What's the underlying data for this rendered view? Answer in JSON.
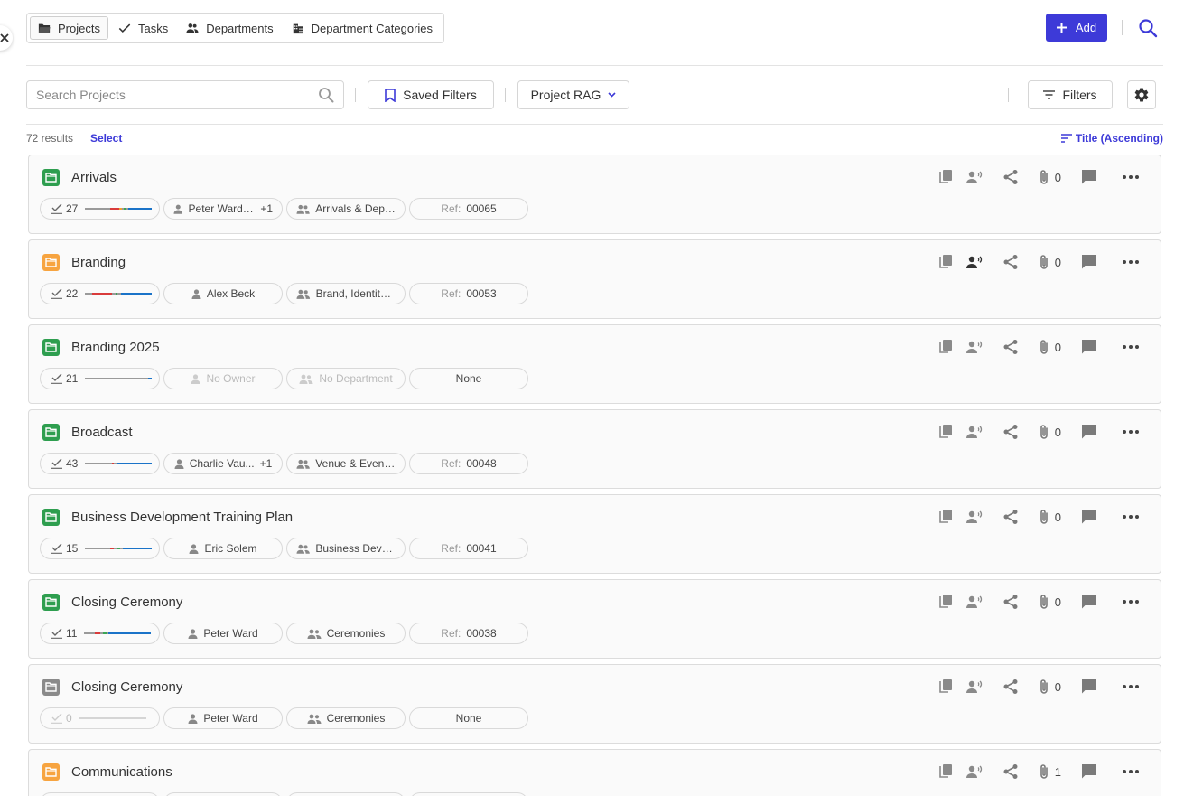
{
  "nav": {
    "tabs": [
      {
        "label": "Projects",
        "icon": "folder-open-icon",
        "active": true
      },
      {
        "label": "Tasks",
        "icon": "checkmark-icon",
        "active": false
      },
      {
        "label": "Departments",
        "icon": "people-icon",
        "active": false
      },
      {
        "label": "Department Categories",
        "icon": "building-icon",
        "active": false
      }
    ],
    "add_label": "Add"
  },
  "toolbar": {
    "search_placeholder": "Search Projects",
    "saved_filters_label": "Saved Filters",
    "rag_label": "Project RAG",
    "filters_label": "Filters"
  },
  "results": {
    "count_label": "72 results",
    "select_label": "Select",
    "sort_label": "Title (Ascending)"
  },
  "colors": {
    "accent": "#3d3ad8",
    "folder_green": "#2e9e4f",
    "folder_orange": "#f7a440",
    "folder_grey": "#8a8a8a",
    "rag_red": "#d93b3b",
    "rag_amber": "#f0a030",
    "rag_green": "#3aa655",
    "rag_blue": "#1a73c8",
    "rag_grey": "#9a9a9a"
  },
  "projects": [
    {
      "title": "Arrivals",
      "folder": "green",
      "tasks": "27",
      "owner": "Peter Ward, ...",
      "owner_extra": "+1",
      "dept": "Arrivals & Depa...",
      "ref_label": "Ref:",
      "ref": "00065",
      "attachments": "0",
      "rag": [
        [
          "grey",
          28
        ],
        [
          "red",
          10
        ],
        [
          "amber",
          3
        ],
        [
          "grey",
          2
        ],
        [
          "green",
          3
        ],
        [
          "grey",
          2
        ],
        [
          "blue",
          26
        ]
      ]
    },
    {
      "title": "Branding",
      "folder": "orange",
      "tasks": "22",
      "owner": "Alex Beck",
      "owner_extra": "",
      "dept": "Brand, Identity ...",
      "ref_label": "Ref:",
      "ref": "00053",
      "attachments": "0",
      "rag": [
        [
          "grey",
          8
        ],
        [
          "red",
          22
        ],
        [
          "grey",
          4
        ],
        [
          "green",
          2
        ],
        [
          "grey",
          4
        ],
        [
          "blue",
          34
        ]
      ]
    },
    {
      "title": "Branding 2025",
      "folder": "green",
      "tasks": "21",
      "owner": "No Owner",
      "owner_extra": "",
      "dept": "No Department",
      "ref_label": "",
      "ref": "None",
      "attachments": "0",
      "muted_owner": true,
      "rag": [
        [
          "grey",
          70
        ],
        [
          "blue",
          4
        ]
      ]
    },
    {
      "title": "Broadcast",
      "folder": "green",
      "tasks": "43",
      "owner": "Charlie Vau...",
      "owner_extra": "+1",
      "dept": "Venue & Event ...",
      "ref_label": "Ref:",
      "ref": "00048",
      "attachments": "0",
      "rag": [
        [
          "grey",
          30
        ],
        [
          "red",
          2
        ],
        [
          "grey",
          4
        ],
        [
          "blue",
          38
        ]
      ]
    },
    {
      "title": "Business Development Training Plan",
      "folder": "green",
      "tasks": "15",
      "owner": "Eric Solem",
      "owner_extra": "",
      "dept": "Business Devel...",
      "ref_label": "Ref:",
      "ref": "00041",
      "attachments": "0",
      "rag": [
        [
          "grey",
          28
        ],
        [
          "red",
          4
        ],
        [
          "grey",
          3
        ],
        [
          "green",
          4
        ],
        [
          "grey",
          3
        ],
        [
          "blue",
          32
        ]
      ]
    },
    {
      "title": "Closing Ceremony",
      "folder": "green",
      "tasks": "11",
      "owner": "Peter Ward",
      "owner_extra": "",
      "dept": "Ceremonies",
      "ref_label": "Ref:",
      "ref": "00038",
      "attachments": "0",
      "rag": [
        [
          "grey",
          12
        ],
        [
          "red",
          6
        ],
        [
          "grey",
          3
        ],
        [
          "green",
          4
        ],
        [
          "grey",
          2
        ],
        [
          "blue",
          47
        ]
      ]
    },
    {
      "title": "Closing Ceremony",
      "folder": "grey",
      "tasks": "0",
      "owner": "Peter Ward",
      "owner_extra": "",
      "dept": "Ceremonies",
      "ref_label": "",
      "ref": "None",
      "attachments": "0",
      "muted_tasks": true,
      "rag": [
        [
          "lightgrey",
          74
        ]
      ]
    },
    {
      "title": "Communications",
      "folder": "orange",
      "tasks": "",
      "owner": "",
      "owner_extra": "",
      "dept": "",
      "ref_label": "",
      "ref": "",
      "attachments": "1",
      "rag": []
    }
  ]
}
